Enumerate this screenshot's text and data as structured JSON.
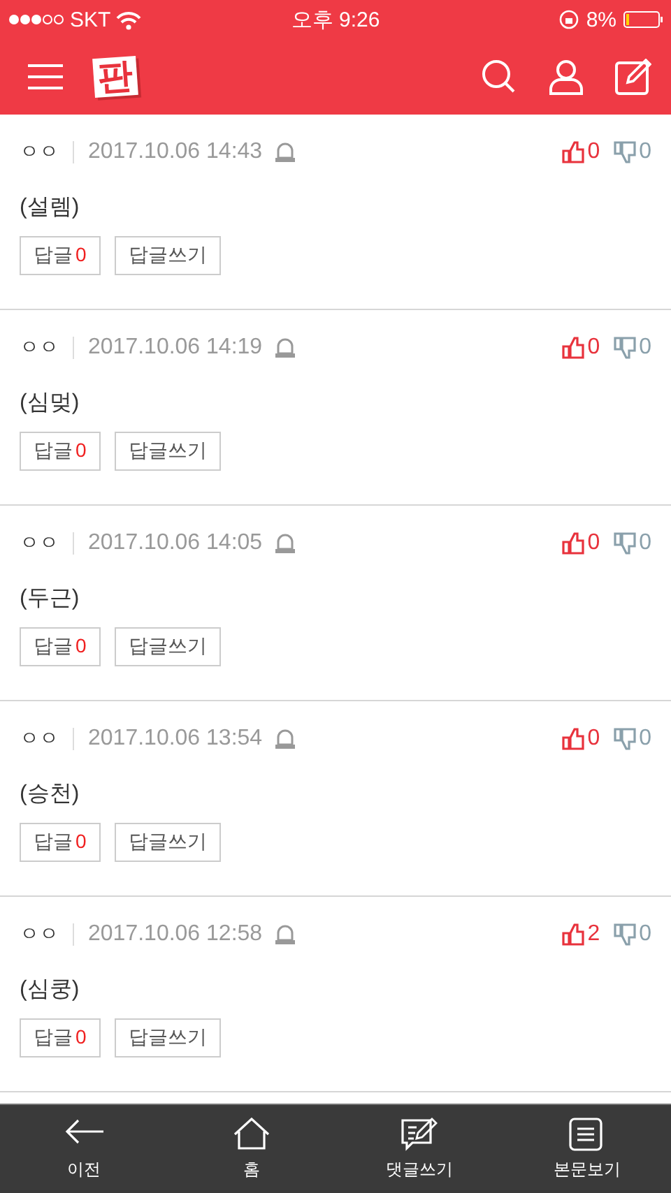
{
  "status_bar": {
    "carrier": "SKT",
    "time": "오후 9:26",
    "battery": "8%"
  },
  "header": {
    "logo": "판"
  },
  "comments": [
    {
      "author": "ㅇㅇ",
      "date": "2017.10.06 14:43",
      "text": "(설렘)",
      "likes": "0",
      "dislikes": "0",
      "reply_label": "답글",
      "reply_count": "0",
      "write_reply": "답글쓰기"
    },
    {
      "author": "ㅇㅇ",
      "date": "2017.10.06 14:19",
      "text": "(심멎)",
      "likes": "0",
      "dislikes": "0",
      "reply_label": "답글",
      "reply_count": "0",
      "write_reply": "답글쓰기"
    },
    {
      "author": "ㅇㅇ",
      "date": "2017.10.06 14:05",
      "text": "(두근)",
      "likes": "0",
      "dislikes": "0",
      "reply_label": "답글",
      "reply_count": "0",
      "write_reply": "답글쓰기"
    },
    {
      "author": "ㅇㅇ",
      "date": "2017.10.06 13:54",
      "text": "(승천)",
      "likes": "0",
      "dislikes": "0",
      "reply_label": "답글",
      "reply_count": "0",
      "write_reply": "답글쓰기"
    },
    {
      "author": "ㅇㅇ",
      "date": "2017.10.06 12:58",
      "text": "(심쿵)",
      "likes": "2",
      "dislikes": "0",
      "reply_label": "답글",
      "reply_count": "0",
      "write_reply": "답글쓰기"
    }
  ],
  "bottom_bar": [
    {
      "kind": "back",
      "label": "이전"
    },
    {
      "kind": "home",
      "label": "홈"
    },
    {
      "kind": "comment",
      "label": "댓글쓰기"
    },
    {
      "kind": "article",
      "label": "본문보기"
    }
  ]
}
